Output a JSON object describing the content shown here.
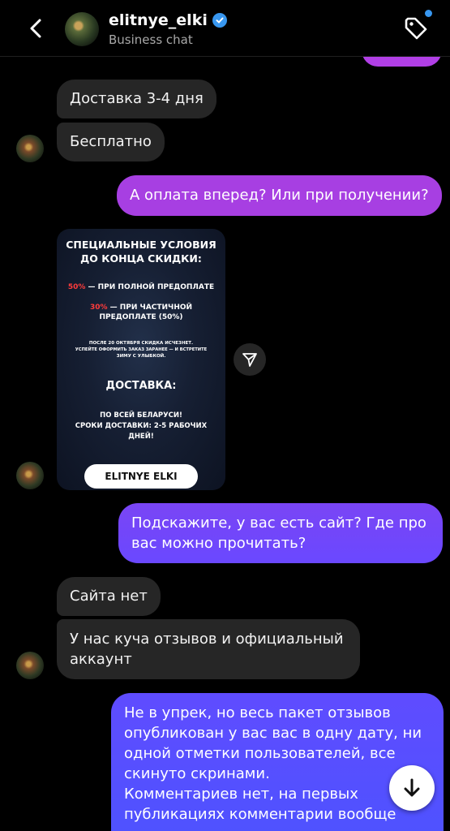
{
  "header": {
    "username": "elitnye_elki",
    "subtitle": "Business chat",
    "verified_color": "#3897f0",
    "back_icon": "chevron-left-icon",
    "tag_icon": "tag-icon"
  },
  "messages": [
    {
      "from": "them",
      "text": "Доставка 3-4 дня"
    },
    {
      "from": "them",
      "text": "Бесплатно"
    },
    {
      "from": "me",
      "text": "А оплата вперед? Или при получении?"
    },
    {
      "from": "them",
      "type": "image"
    },
    {
      "from": "me",
      "lines": [
        "Подскажите, у вас есть сайт? Где про",
        "вас можно прочитать?"
      ]
    },
    {
      "from": "them",
      "text": "Сайта нет"
    },
    {
      "from": "them",
      "lines": [
        "У нас куча отзывов и официальный",
        "аккаунт"
      ]
    },
    {
      "from": "me",
      "lines": [
        "Не в упрек, но весь пакет отзывов",
        "опубликован у вас вас в одну дату, ни",
        "одной отметки пользователей, все",
        "скинуто скринами.",
        "Комментариев нет, на первых",
        "публикациях комментарии вообще"
      ]
    }
  ],
  "promo_image": {
    "title_1": "СПЕЦИАЛЬНЫЕ УСЛОВИЯ",
    "title_2": "ДО КОНЦА СКИДКИ:",
    "offer_1_pct": "50%",
    "offer_1_text": " — ПРИ ПОЛНОЙ ПРЕДОПЛАТЕ",
    "offer_2_pct": "30%",
    "offer_2_text": " — ПРИ ЧАСТИЧНОЙ",
    "offer_2_text_2": "ПРЕДОПЛАТЕ (50%)",
    "note_1": "ПОСЛЕ 20 ОКТЯБРЯ СКИДКА ИСЧЕЗНЕТ.",
    "note_2": "УСПЕЙТЕ ОФОРМИТЬ ЗАКАЗ ЗАРАНЕЕ — И ВСТРЕТИТЕ",
    "note_3": "ЗИМУ С УЛЫБКОЙ.",
    "delivery_title": "ДОСТАВКА:",
    "delivery_1": "ПО ВСЕЙ БЕЛАРУСИ!",
    "delivery_2": "СРОКИ ДОСТАВКИ: 2-5 РАБОЧИХ",
    "delivery_3": "ДНЕЙ!",
    "button_label": "ELITNYE ELKI"
  },
  "colors": {
    "incoming_bubble": "#262626",
    "outgoing_gradient_top": "#a83fe0",
    "outgoing_gradient_bottom": "#5a4bff"
  }
}
